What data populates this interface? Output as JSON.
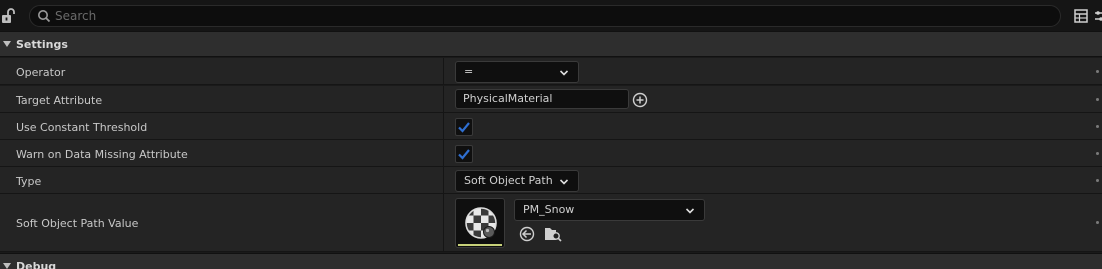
{
  "search": {
    "placeholder": "Search",
    "value": ""
  },
  "icons": {
    "lock": "unlocked-padlock-icon",
    "search": "search-icon",
    "table": "table-view-icon",
    "settings": "settings-icon",
    "add": "plus-circle-icon",
    "browse_back": "use-selected-asset-icon",
    "browse": "browse-to-asset-icon"
  },
  "colors": {
    "check": "#2f6fd1",
    "thumbnail_bar": "#c8d27a"
  },
  "sections": {
    "settings": {
      "title": "Settings",
      "expanded": true
    },
    "debug": {
      "title": "Debug",
      "expanded": true
    }
  },
  "properties": {
    "operator": {
      "label": "Operator",
      "value": "="
    },
    "target_attribute": {
      "label": "Target Attribute",
      "value": "PhysicalMaterial"
    },
    "use_constant_threshold": {
      "label": "Use Constant Threshold",
      "checked": true
    },
    "warn_on_missing": {
      "label": "Warn on Data Missing Attribute",
      "checked": true
    },
    "type": {
      "label": "Type",
      "value": "Soft Object Path"
    },
    "soft_object_path_value": {
      "label": "Soft Object Path Value",
      "value": "PM_Snow"
    }
  }
}
